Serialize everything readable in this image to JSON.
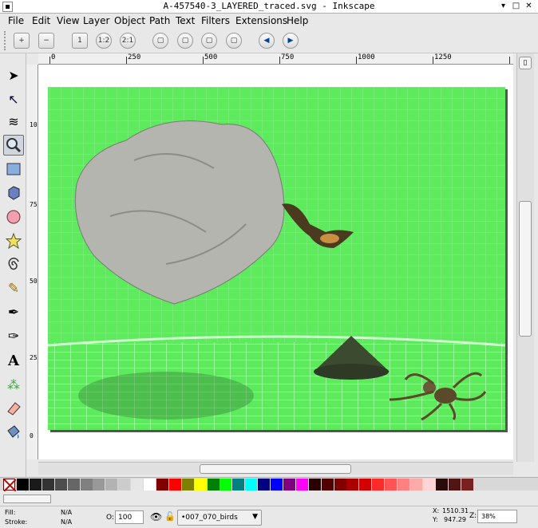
{
  "window": {
    "title": "A-457540-3_LAYERED_traced.svg - Inkscape",
    "buttons": [
      "▾",
      "□",
      "✕"
    ]
  },
  "menu": [
    "File",
    "Edit",
    "View",
    "Layer",
    "Object",
    "Path",
    "Text",
    "Filters",
    "Extensions",
    "Help"
  ],
  "command_bar": {
    "buttons": [
      {
        "name": "zoom-in-button",
        "glyph": "+"
      },
      {
        "name": "zoom-out-button",
        "glyph": "−"
      },
      {
        "name": "zoom-1-1-button",
        "glyph": "1"
      },
      {
        "name": "zoom-1-2-button",
        "glyph": "1:2"
      },
      {
        "name": "zoom-2-1-button",
        "glyph": "2:1"
      },
      {
        "name": "zoom-selection-button",
        "glyph": "▢"
      },
      {
        "name": "zoom-drawing-button",
        "glyph": "▢"
      },
      {
        "name": "zoom-page-button",
        "glyph": "▢"
      },
      {
        "name": "zoom-page-width-button",
        "glyph": "▢"
      },
      {
        "name": "zoom-previous-button",
        "glyph": "◀"
      },
      {
        "name": "zoom-next-button",
        "glyph": "▶"
      }
    ]
  },
  "tools": [
    {
      "name": "selector-tool",
      "glyph": "➤"
    },
    {
      "name": "node-tool",
      "glyph": "↖"
    },
    {
      "name": "tweak-tool",
      "glyph": "≋"
    },
    {
      "name": "zoom-tool",
      "glyph": "🔍",
      "active": true
    },
    {
      "name": "rectangle-tool",
      "glyph": "■"
    },
    {
      "name": "3d-box-tool",
      "glyph": "⬢"
    },
    {
      "name": "ellipse-tool",
      "glyph": "●"
    },
    {
      "name": "star-tool",
      "glyph": "★"
    },
    {
      "name": "spiral-tool",
      "glyph": "@"
    },
    {
      "name": "pencil-tool",
      "glyph": "✎"
    },
    {
      "name": "pen-tool",
      "glyph": "✒"
    },
    {
      "name": "calligraphy-tool",
      "glyph": "✑"
    },
    {
      "name": "text-tool",
      "glyph": "A"
    },
    {
      "name": "spray-tool",
      "glyph": "⁂"
    },
    {
      "name": "eraser-tool",
      "glyph": "◧"
    },
    {
      "name": "paint-bucket-tool",
      "glyph": "⛾"
    }
  ],
  "ruler": {
    "h_labels": [
      "0",
      "250",
      "500",
      "750",
      "1000",
      "1250"
    ],
    "v_labels": [
      "1000",
      "750",
      "500",
      "250",
      "0"
    ]
  },
  "palette": {
    "colors": [
      "#000000",
      "#1a1a1a",
      "#333333",
      "#4d4d4d",
      "#666666",
      "#808080",
      "#999999",
      "#b3b3b3",
      "#cccccc",
      "#e6e6e6",
      "#ffffff",
      "#800000",
      "#ff0000",
      "#808000",
      "#ffff00",
      "#008000",
      "#00ff00",
      "#008080",
      "#00ffff",
      "#000080",
      "#0000ff",
      "#800080",
      "#ff00ff",
      "#2b0000",
      "#550000",
      "#800000",
      "#aa0000",
      "#d40000",
      "#ff2a2a",
      "#ff5555",
      "#ff8080",
      "#ffaaaa",
      "#ffd5d5",
      "#280b0b",
      "#501616",
      "#782121"
    ]
  },
  "status": {
    "fill_label": "Fill:",
    "fill_value": "N/A",
    "stroke_label": "Stroke:",
    "stroke_value": "N/A",
    "opacity_label": "O:",
    "opacity_value": "100",
    "layer_name": "•007_070_birds",
    "x_label": "X:",
    "x_value": "1510.31",
    "y_label": "Y:",
    "y_value": "947.29",
    "zoom_label": "Z:",
    "zoom_value": "38%"
  }
}
